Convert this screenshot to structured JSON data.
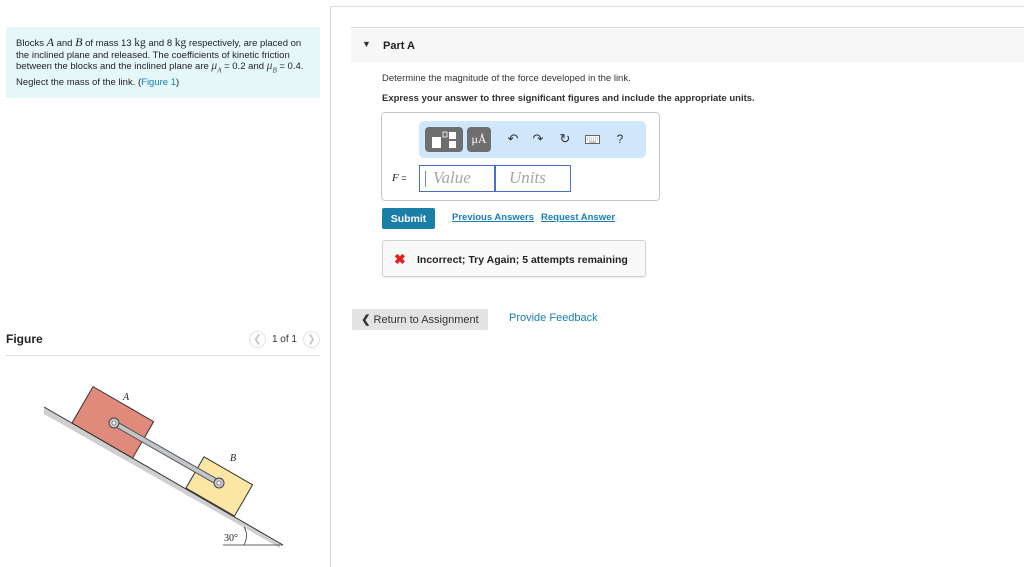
{
  "problem": {
    "text_1": "Blocks ",
    "block_a": "A",
    "text_2": " and ",
    "block_b": "B",
    "text_3": " of mass 13 ",
    "unit_1": "kg",
    "text_4": " and 8 ",
    "unit_2": "kg",
    "text_5": " respectively, are placed on the inclined plane and released. The coefficients of kinetic friction between the blocks and the inclined plane are ",
    "mu": "μ",
    "sub_a": "A",
    "text_6": " = 0.2 and ",
    "sub_b": "B",
    "text_7": " = 0.4. Neglect the mass of the link. (",
    "figure_link": "Figure 1",
    "text_8": ")"
  },
  "figure": {
    "title": "Figure",
    "counter": "1 of 1",
    "prev_icon": "chevron-left-icon",
    "next_icon": "chevron-right-icon",
    "label_a": "A",
    "label_b": "B",
    "angle_label": "30°",
    "colors": {
      "block_a": "#e08a7c",
      "block_b": "#fce6a4",
      "plane": "#cfcfcf",
      "link": "#b5b9bd"
    }
  },
  "part": {
    "toggle_icon": "triangle-down-icon",
    "title": "Part A",
    "question": "Determine the magnitude of the force developed in the link.",
    "instruction": "Express your answer to three significant figures and include the appropriate units."
  },
  "answer": {
    "toolbar": {
      "templates_icon": "templates-icon",
      "symbols_label": "μÅ",
      "undo_icon": "undo-icon",
      "redo_icon": "redo-icon",
      "reset_icon": "reset-icon",
      "keyboard_icon": "keyboard-icon",
      "help_label": "?"
    },
    "variable": "F",
    "equals": " =",
    "value_placeholder": "Value",
    "units_placeholder": "Units",
    "value": "",
    "units": ""
  },
  "actions": {
    "submit_label": "Submit",
    "previous_answers_label": "Previous Answers",
    "request_answer_label": "Request Answer"
  },
  "feedback": {
    "icon": "x-icon",
    "message": "Incorrect; Try Again; 5 attempts remaining",
    "icon_color": "#e41d1d"
  },
  "footer": {
    "return_label": "Return to Assignment",
    "feedback_label": "Provide Feedback"
  },
  "colors": {
    "accent": "#1a7fa8",
    "link": "#1a7fb3",
    "problem_bg": "#e6f7fa",
    "toolbar_bg": "#cfe6fb"
  }
}
